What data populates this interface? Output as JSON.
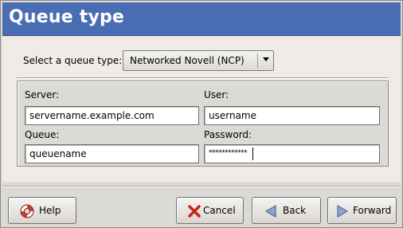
{
  "window": {
    "title": "Queue type",
    "header_color": "#4a6cb3"
  },
  "queue_type": {
    "label": "Select a queue type:",
    "selected": "Networked Novell (NCP)"
  },
  "fields": {
    "server": {
      "label": "Server:",
      "value": "servername.example.com"
    },
    "user": {
      "label": "User:",
      "value": "username"
    },
    "queue": {
      "label": "Queue:",
      "value": "queuename"
    },
    "password": {
      "label": "Password:",
      "value": "************"
    }
  },
  "buttons": {
    "help": {
      "label": "Help",
      "icon": "lifebuoy-icon"
    },
    "cancel": {
      "label": "Cancel",
      "icon": "red-x-icon"
    },
    "back": {
      "label": "Back",
      "icon": "left-arrow-icon"
    },
    "forward": {
      "label": "Forward",
      "icon": "right-arrow-icon"
    }
  }
}
